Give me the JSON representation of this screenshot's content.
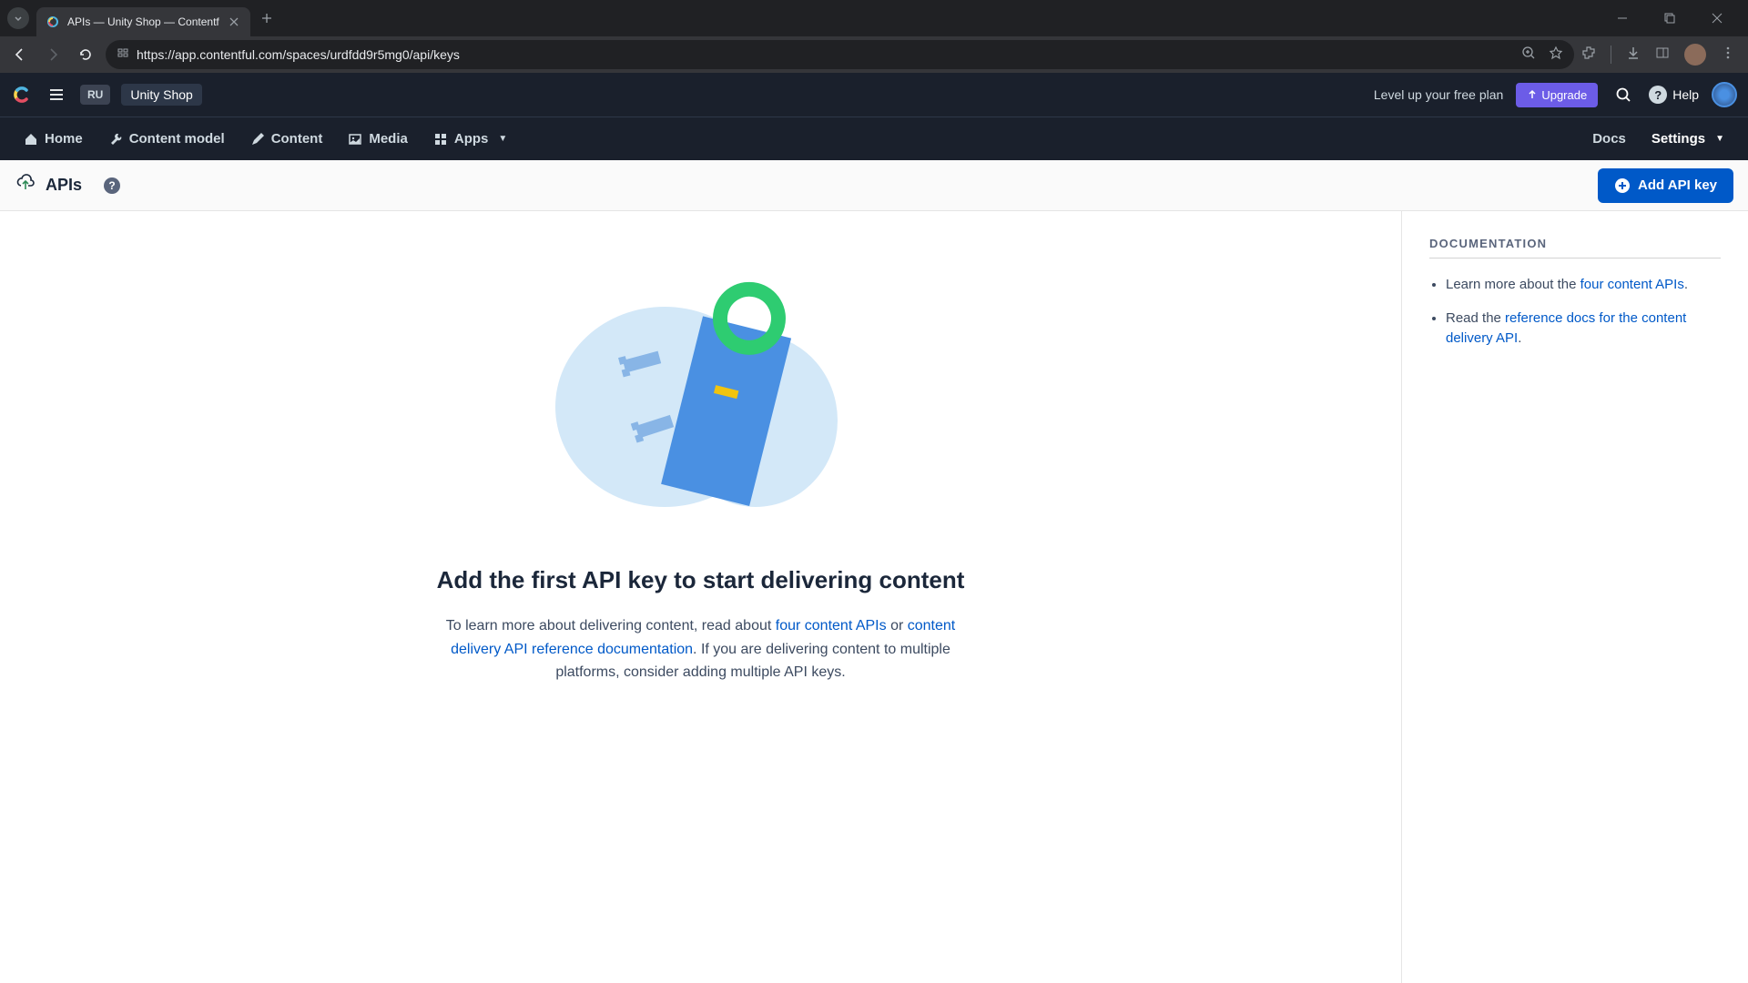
{
  "browser": {
    "tab_title": "APIs — Unity Shop — Contentf",
    "url": "https://app.contentful.com/spaces/urdfdd9r5mg0/api/keys"
  },
  "header": {
    "env_badge": "RU",
    "space_name": "Unity Shop",
    "plan_text": "Level up your free plan",
    "upgrade_label": "Upgrade",
    "help_label": "Help"
  },
  "nav": {
    "items": [
      {
        "label": "Home"
      },
      {
        "label": "Content model"
      },
      {
        "label": "Content"
      },
      {
        "label": "Media"
      },
      {
        "label": "Apps"
      }
    ],
    "right": [
      {
        "label": "Docs"
      },
      {
        "label": "Settings"
      }
    ]
  },
  "sub_header": {
    "title": "APIs",
    "add_button": "Add API key"
  },
  "empty_state": {
    "title": "Add the first API key to start delivering content",
    "desc_pre": "To learn more about delivering content, read about ",
    "link1": "four content APIs",
    "desc_mid": " or ",
    "link2": "content delivery API reference documentation",
    "desc_post": ". If you are delivering content to multiple platforms, consider adding multiple API keys."
  },
  "sidebar": {
    "heading": "DOCUMENTATION",
    "item1_pre": "Learn more about the ",
    "item1_link": "four content APIs",
    "item1_post": ".",
    "item2_pre": "Read the ",
    "item2_link": "reference docs for the content delivery API",
    "item2_post": "."
  }
}
